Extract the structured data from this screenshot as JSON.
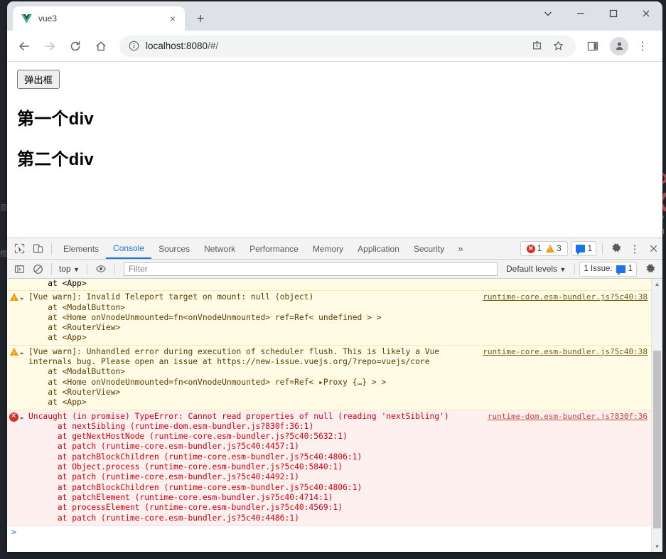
{
  "browser": {
    "tab": {
      "title": "vue3",
      "favicon": "vue-logo-icon",
      "close": "×"
    },
    "new_tab_label": "+",
    "window_controls": {
      "minimize": "–",
      "maximize": "□",
      "close": "×",
      "chevron": "⌄"
    },
    "nav": {
      "back": "←",
      "forward": "→",
      "reload": "↻",
      "home": "⌂",
      "share": "share-icon",
      "bookmark": "star-icon",
      "sidepanel": "side-panel-icon",
      "profile": "avatar-icon",
      "menu": "⋮"
    },
    "omnibox": {
      "site_info_icon": "info-circle-icon",
      "url_host": "localhost:8080",
      "url_path": "/#/",
      "url_full": "localhost:8080/#/"
    }
  },
  "page": {
    "button_label": "弹出框",
    "heading1": "第一个div",
    "heading2": "第二个div"
  },
  "devtools": {
    "inspect_icon": "inspect-element-icon",
    "device_icon": "device-toolbar-icon",
    "tabs": [
      {
        "label": "Elements",
        "active": false
      },
      {
        "label": "Console",
        "active": true
      },
      {
        "label": "Sources",
        "active": false
      },
      {
        "label": "Network",
        "active": false
      },
      {
        "label": "Performance",
        "active": false
      },
      {
        "label": "Memory",
        "active": false
      },
      {
        "label": "Application",
        "active": false
      },
      {
        "label": "Security",
        "active": false
      }
    ],
    "more_tabs": "»",
    "counters": {
      "errors": "1",
      "warnings": "3",
      "messages": "1"
    },
    "settings_icon": "gear-icon",
    "kebab_icon": "more-options-icon",
    "close_icon": "close-devtools-icon",
    "console_toolbar": {
      "sidebar_icon": "console-sidebar-icon",
      "clear_icon": "clear-console-icon",
      "context": "top",
      "context_caret": "▼",
      "eye_icon": "live-expression-icon",
      "filter_placeholder": "Filter",
      "filter_value": "",
      "levels": "Default levels",
      "levels_caret": "▼",
      "issues_label": "1 Issue:",
      "issues_count": "1",
      "settings_icon": "console-settings-icon"
    },
    "messages": [
      {
        "type": "partial",
        "lines": [
          "    at <App>"
        ],
        "source": ""
      },
      {
        "type": "warn",
        "expandable": true,
        "lines": [
          "[Vue warn]: Invalid Teleport target on mount: null (object)",
          "    at <ModalButton>",
          "    at <Home onVnodeUnmounted=fn<onVnodeUnmounted> ref=Ref< undefined > >",
          "    at <RouterView>",
          "    at <App>"
        ],
        "source": "runtime-core.esm-bundler.js?5c40:38"
      },
      {
        "type": "warn",
        "expandable": true,
        "lines": [
          "[Vue warn]: Unhandled error during execution of scheduler flush. This is likely a Vue",
          "internals bug. Please open an issue at https://new-issue.vuejs.org/?repo=vuejs/core",
          "    at <ModalButton>",
          "    at <Home onVnodeUnmounted=fn<onVnodeUnmounted> ref=Ref< ▸Proxy {…} > >",
          "    at <RouterView>",
          "    at <App>"
        ],
        "source": "runtime-core.esm-bundler.js?5c40:38"
      },
      {
        "type": "err",
        "expandable": true,
        "lines": [
          "Uncaught (in promise) TypeError: Cannot read properties of null (reading 'nextSibling')",
          "      at nextSibling (runtime-dom.esm-bundler.js?830f:36:1)",
          "      at getNextHostNode (runtime-core.esm-bundler.js?5c40:5632:1)",
          "      at patch (runtime-core.esm-bundler.js?5c40:4457:1)",
          "      at patchBlockChildren (runtime-core.esm-bundler.js?5c40:4806:1)",
          "      at Object.process (runtime-core.esm-bundler.js?5c40:5840:1)",
          "      at patch (runtime-core.esm-bundler.js?5c40:4492:1)",
          "      at patchBlockChildren (runtime-core.esm-bundler.js?5c40:4806:1)",
          "      at patchElement (runtime-core.esm-bundler.js?5c40:4714:1)",
          "      at processElement (runtime-core.esm-bundler.js?5c40:4569:1)",
          "      at patch (runtime-core.esm-bundler.js?5c40:4486:1)"
        ],
        "source": "runtime-dom.esm-bundler.js?830f:36"
      }
    ],
    "prompt": ">"
  },
  "colors": {
    "accent": "#1a73e8",
    "error": "#d93025",
    "warning": "#f29900",
    "warn_bg": "#fffbe5",
    "err_bg": "#fff0f0",
    "desktop": "#21252b"
  }
}
